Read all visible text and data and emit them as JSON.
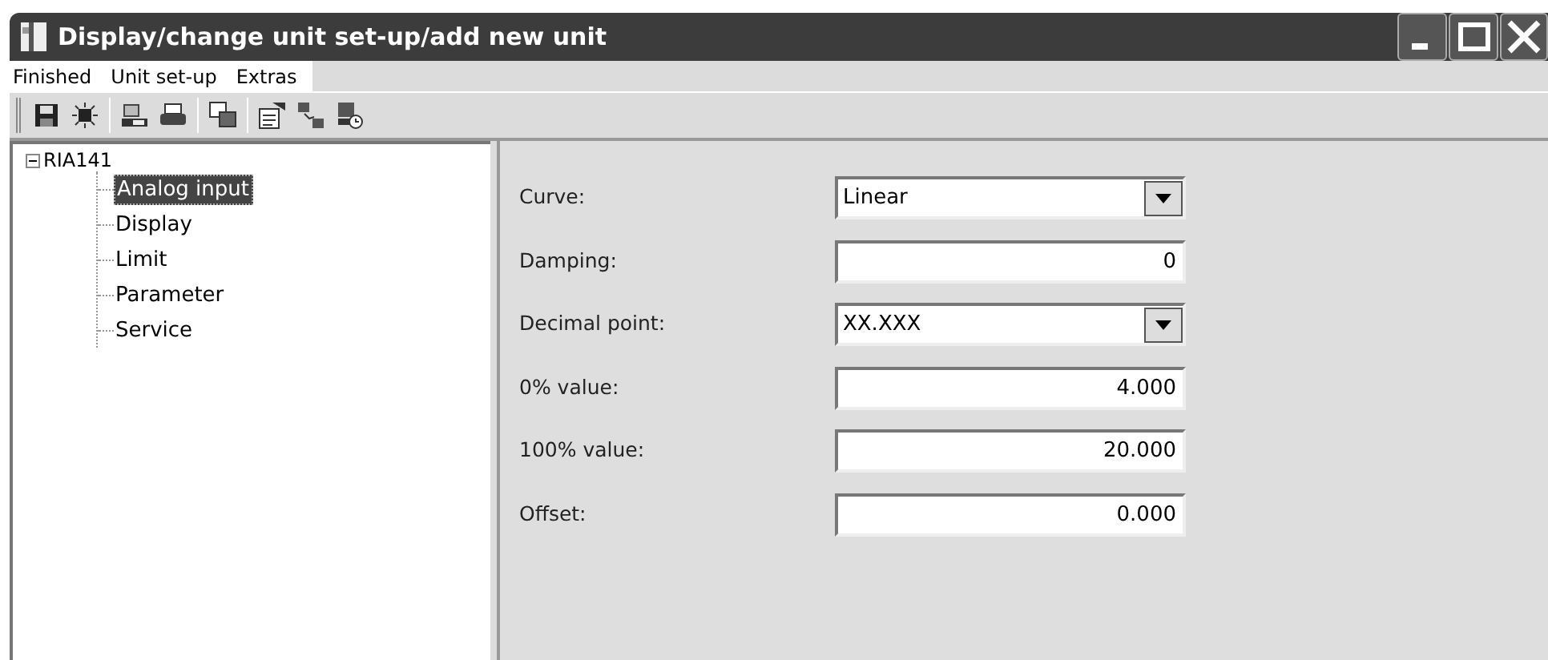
{
  "window": {
    "title": "Display/change unit set-up/add new unit"
  },
  "menu": [
    {
      "label": "Finished"
    },
    {
      "label": "Unit set-up"
    },
    {
      "label": "Extras"
    }
  ],
  "tree": {
    "label": "RIA141",
    "expanded": true,
    "children": [
      {
        "label": "Analog input",
        "selected": true
      },
      {
        "label": "Display",
        "selected": false
      },
      {
        "label": "Limit",
        "selected": false
      },
      {
        "label": "Parameter",
        "selected": false
      },
      {
        "label": "Service",
        "selected": false
      }
    ]
  },
  "fields": [
    {
      "label": "Curve:",
      "kind": "dropdown",
      "value": "Linear"
    },
    {
      "label": "Damping:",
      "kind": "text",
      "value": "0"
    },
    {
      "label": "Decimal point:",
      "kind": "dropdown",
      "value": "XX.XXX"
    },
    {
      "label": "0% value:",
      "kind": "text",
      "value": "4.000"
    },
    {
      "label": "100% value:",
      "kind": "text",
      "value": "20.000"
    },
    {
      "label": "Offset:",
      "kind": "text",
      "value": "0.000"
    }
  ]
}
